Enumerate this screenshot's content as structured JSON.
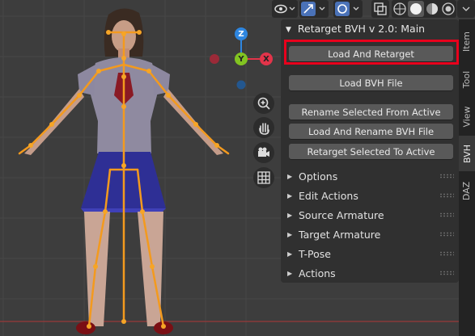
{
  "panel": {
    "title": "Retarget BVH v 2.0: Main",
    "buttons": [
      "Load And Retarget",
      "Load BVH File",
      "Rename Selected From Active",
      "Load And Rename BVH File",
      "Retarget Selected To Active"
    ],
    "sections": [
      "Options",
      "Edit Actions",
      "Source Armature",
      "Target Armature",
      "T-Pose",
      "Actions"
    ]
  },
  "tabs": [
    "Item",
    "Tool",
    "View",
    "BVH",
    "DAZ"
  ],
  "active_tab": "BVH",
  "gizmo": {
    "z": "Z",
    "y": "Y",
    "x": "X"
  },
  "tools": [
    "zoom-icon",
    "hand-pan-icon",
    "camera-icon",
    "grid-icon"
  ],
  "header_icons": [
    "visibility-icon",
    "gizmo-icon",
    "overlay-icon",
    "xray-icon",
    "wireframe-shading-icon",
    "solid-shading-icon",
    "material-shading-icon",
    "rendered-shading-icon"
  ],
  "colors": {
    "highlight": "#e8001c",
    "bone": "#f39a1e",
    "axis_x": "#e3344a",
    "axis_y": "#82c421",
    "axis_z": "#2e86e0"
  }
}
